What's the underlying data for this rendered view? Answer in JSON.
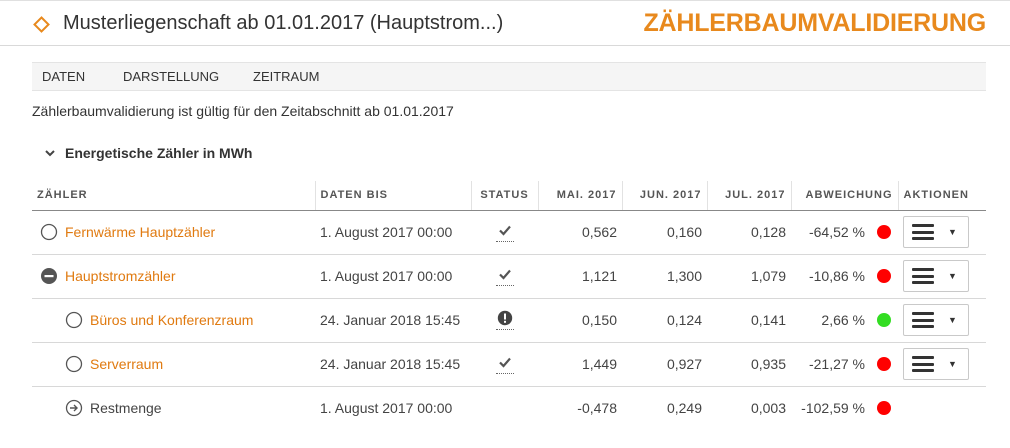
{
  "header": {
    "title": "Musterliegenschaft ab 01.01.2017 (Hauptstrom...)",
    "app_title": "ZÄHLERBAUMVALIDIERUNG",
    "icon": "diamond-icon"
  },
  "menu": {
    "items": [
      {
        "label": "DATEN"
      },
      {
        "label": "DARSTELLUNG"
      },
      {
        "label": "ZEITRAUM"
      }
    ]
  },
  "validity_text": "Zählerbaumvalidierung ist gültig für den Zeitabschnitt ab 01.01.2017",
  "section": {
    "title": "Energetische Zähler in MWh",
    "expanded": true
  },
  "table": {
    "columns": {
      "zaehler": "ZÄHLER",
      "daten_bis": "DATEN BIS",
      "status": "STATUS",
      "mai": "MAI. 2017",
      "jun": "JUN. 2017",
      "jul": "JUL. 2017",
      "abweichung": "ABWEICHUNG",
      "aktionen": "AKTIONEN"
    },
    "rows": [
      {
        "name": "Fernwärme Hauptzähler",
        "node": "circle-empty",
        "indent": 0,
        "link": true,
        "daten_bis": "1. August 2017 00:00",
        "status": "check",
        "mai": "0,562",
        "jun": "0,160",
        "jul": "0,128",
        "abweichung": "-64,52 %",
        "indicator": "red",
        "has_action": true
      },
      {
        "name": "Hauptstromzähler",
        "node": "circle-minus",
        "indent": 0,
        "link": true,
        "daten_bis": "1. August 2017 00:00",
        "status": "check",
        "mai": "1,121",
        "jun": "1,300",
        "jul": "1,079",
        "abweichung": "-10,86 %",
        "indicator": "red",
        "has_action": true
      },
      {
        "name": "Büros und Konferenzraum",
        "node": "circle-empty",
        "indent": 1,
        "link": true,
        "daten_bis": "24. Januar 2018 15:45",
        "status": "warning",
        "mai": "0,150",
        "jun": "0,124",
        "jul": "0,141",
        "abweichung": "2,66 %",
        "indicator": "green",
        "has_action": true
      },
      {
        "name": "Serverraum",
        "node": "circle-empty",
        "indent": 1,
        "link": true,
        "daten_bis": "24. Januar 2018 15:45",
        "status": "check",
        "mai": "1,449",
        "jun": "0,927",
        "jul": "0,935",
        "abweichung": "-21,27 %",
        "indicator": "red",
        "has_action": true
      },
      {
        "name": "Restmenge",
        "node": "circle-arrow",
        "indent": 1,
        "link": false,
        "daten_bis": "1. August 2017 00:00",
        "status": "none",
        "mai": "-0,478",
        "jun": "0,249",
        "jul": "0,003",
        "abweichung": "-102,59 %",
        "indicator": "red",
        "has_action": false
      }
    ]
  },
  "colors": {
    "accent": "#e8891d",
    "link": "#e07a10",
    "status_red": "#ff0000",
    "status_green": "#33dd22"
  }
}
